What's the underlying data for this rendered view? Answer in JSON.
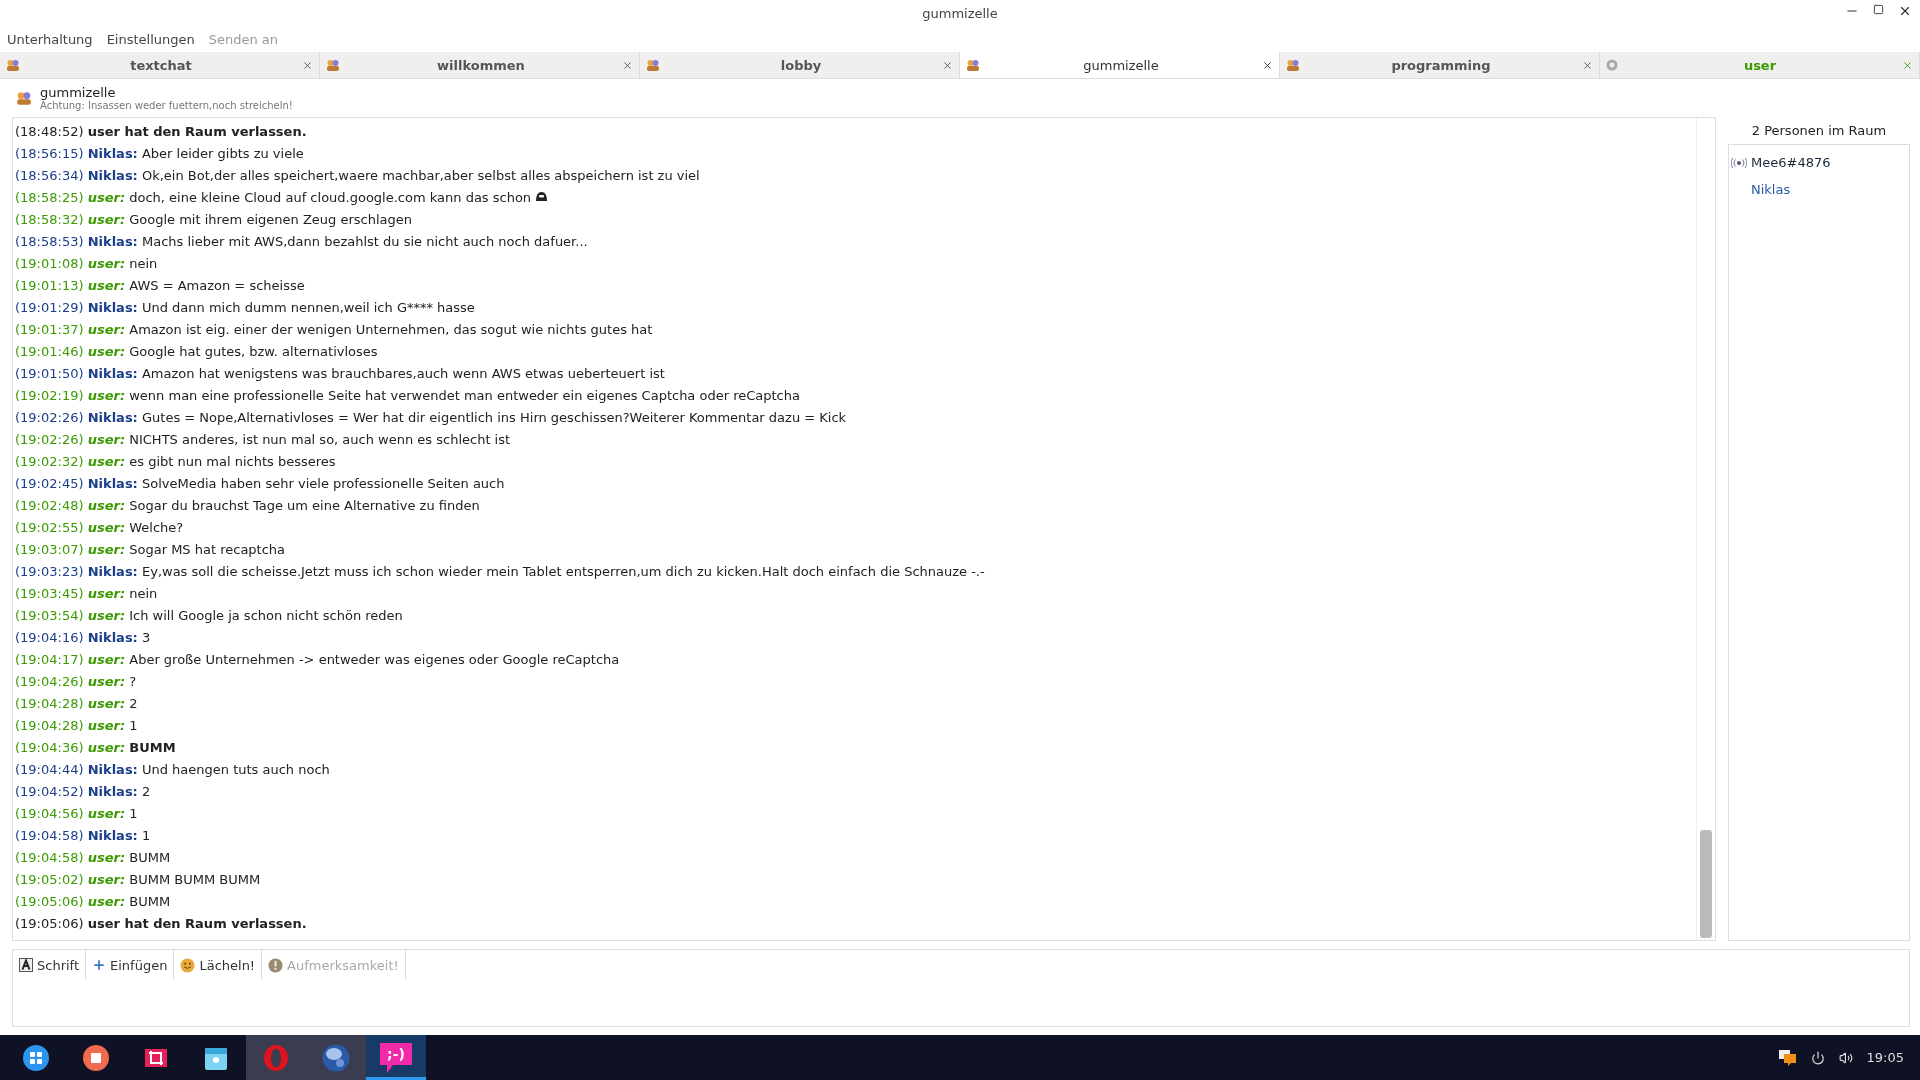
{
  "window": {
    "title": "gummizelle"
  },
  "menu": [
    "Unterhaltung",
    "Einstellungen",
    {
      "label": "Senden an",
      "disabled": true
    }
  ],
  "tabs": [
    {
      "label": "textchat",
      "selected": false,
      "highlighted": false,
      "kind": "group"
    },
    {
      "label": "willkommen",
      "selected": false,
      "highlighted": false,
      "kind": "group"
    },
    {
      "label": "lobby",
      "selected": false,
      "highlighted": false,
      "kind": "group"
    },
    {
      "label": "gummizelle",
      "selected": true,
      "highlighted": false,
      "kind": "group"
    },
    {
      "label": "programming",
      "selected": false,
      "highlighted": false,
      "kind": "group"
    },
    {
      "label": "user",
      "selected": false,
      "highlighted": true,
      "kind": "private"
    }
  ],
  "room": {
    "name": "gummizelle",
    "topic": "Achtung: Insassen weder fuettern,noch streicheln!"
  },
  "messages": [
    {
      "kind": "system",
      "time": "(18:48:52)",
      "text": "user hat den Raum verlassen."
    },
    {
      "kind": "other",
      "time": "(18:56:15)",
      "nick": "Niklas:",
      "text": "Aber leider gibts zu viele"
    },
    {
      "kind": "other",
      "time": "(18:56:34)",
      "nick": "Niklas:",
      "text": "Ok,ein Bot,der alles speichert,waere machbar,aber selbst alles abspeichern ist zu viel"
    },
    {
      "kind": "self",
      "time": "(18:58:25)",
      "nick": "user:",
      "text": "doch, eine kleine Cloud auf cloud.google.com kann das schon",
      "emoji": true
    },
    {
      "kind": "self",
      "time": "(18:58:32)",
      "nick": "user:",
      "text": "Google mit ihrem eigenen Zeug erschlagen"
    },
    {
      "kind": "other",
      "time": "(18:58:53)",
      "nick": "Niklas:",
      "text": "Machs lieber mit AWS,dann bezahlst du sie nicht auch noch dafuer..."
    },
    {
      "kind": "self",
      "time": "(19:01:08)",
      "nick": "user:",
      "text": "nein"
    },
    {
      "kind": "self",
      "time": "(19:01:13)",
      "nick": "user:",
      "text": "AWS = Amazon = scheisse"
    },
    {
      "kind": "other",
      "time": "(19:01:29)",
      "nick": "Niklas:",
      "text": "Und dann mich dumm nennen,weil ich G**** hasse"
    },
    {
      "kind": "self",
      "time": "(19:01:37)",
      "nick": "user:",
      "text": "Amazon ist eig. einer der wenigen Unternehmen, das sogut wie nichts gutes hat"
    },
    {
      "kind": "self",
      "time": "(19:01:46)",
      "nick": "user:",
      "text": "Google hat gutes, bzw. alternativloses"
    },
    {
      "kind": "other",
      "time": "(19:01:50)",
      "nick": "Niklas:",
      "text": "Amazon hat wenigstens was brauchbares,auch wenn AWS etwas ueberteuert ist"
    },
    {
      "kind": "self",
      "time": "(19:02:19)",
      "nick": "user:",
      "text": "wenn man eine professionelle Seite hat verwendet man entweder ein eigenes Captcha oder reCaptcha"
    },
    {
      "kind": "other",
      "time": "(19:02:26)",
      "nick": "Niklas:",
      "text": "Gutes = Nope,Alternativloses = Wer hat dir eigentlich ins Hirn geschissen?Weiterer Kommentar dazu = Kick"
    },
    {
      "kind": "self",
      "time": "(19:02:26)",
      "nick": "user:",
      "text": "NICHTS anderes, ist nun mal so, auch wenn es schlecht ist"
    },
    {
      "kind": "self",
      "time": "(19:02:32)",
      "nick": "user:",
      "text": "es gibt nun mal nichts besseres"
    },
    {
      "kind": "other",
      "time": "(19:02:45)",
      "nick": "Niklas:",
      "text": "SolveMedia haben sehr viele professionelle Seiten auch"
    },
    {
      "kind": "self",
      "time": "(19:02:48)",
      "nick": "user:",
      "text": "Sogar du brauchst Tage um eine Alternative zu finden"
    },
    {
      "kind": "self",
      "time": "(19:02:55)",
      "nick": "user:",
      "text": "Welche?"
    },
    {
      "kind": "self",
      "time": "(19:03:07)",
      "nick": "user:",
      "text": "Sogar MS hat recaptcha"
    },
    {
      "kind": "other",
      "time": "(19:03:23)",
      "nick": "Niklas:",
      "text": "Ey,was soll die scheisse.Jetzt muss ich schon wieder mein Tablet entsperren,um dich zu kicken.Halt doch einfach die Schnauze -.-"
    },
    {
      "kind": "self",
      "time": "(19:03:45)",
      "nick": "user:",
      "text": "nein"
    },
    {
      "kind": "self",
      "time": "(19:03:54)",
      "nick": "user:",
      "text": "Ich will Google ja schon nicht schön reden"
    },
    {
      "kind": "other",
      "time": "(19:04:16)",
      "nick": "Niklas:",
      "text": "3"
    },
    {
      "kind": "self",
      "time": "(19:04:17)",
      "nick": "user:",
      "text": "Aber große Unternehmen -> entweder was eigenes oder Google reCaptcha"
    },
    {
      "kind": "self",
      "time": "(19:04:26)",
      "nick": "user:",
      "text": "?"
    },
    {
      "kind": "self",
      "time": "(19:04:28)",
      "nick": "user:",
      "text": "2"
    },
    {
      "kind": "self",
      "time": "(19:04:28)",
      "nick": "user:",
      "text": "1"
    },
    {
      "kind": "self",
      "time": "(19:04:36)",
      "nick": "user:",
      "text": "BUMM",
      "bold": true
    },
    {
      "kind": "other",
      "time": "(19:04:44)",
      "nick": "Niklas:",
      "text": "Und haengen tuts auch noch"
    },
    {
      "kind": "other",
      "time": "(19:04:52)",
      "nick": "Niklas:",
      "text": "2"
    },
    {
      "kind": "self",
      "time": "(19:04:56)",
      "nick": "user:",
      "text": "1"
    },
    {
      "kind": "other",
      "time": "(19:04:58)",
      "nick": "Niklas:",
      "text": "1"
    },
    {
      "kind": "self",
      "time": "(19:04:58)",
      "nick": "user:",
      "text": "BUMM"
    },
    {
      "kind": "self",
      "time": "(19:05:02)",
      "nick": "user:",
      "text": "BUMM BUMM BUMM"
    },
    {
      "kind": "self",
      "time": "(19:05:06)",
      "nick": "user:",
      "text": "BUMM"
    },
    {
      "kind": "system",
      "time": "(19:05:06)",
      "text": "user hat den Raum verlassen."
    }
  ],
  "members": {
    "title": "2 Personen im Raum",
    "items": [
      {
        "name": "Mee6#4876",
        "kind": "bot"
      },
      {
        "name": "Niklas",
        "kind": "person"
      }
    ]
  },
  "toolbar": [
    {
      "label": "Schrift",
      "kind": "font",
      "disabled": false
    },
    {
      "label": "Einfügen",
      "kind": "insert",
      "disabled": false
    },
    {
      "label": "Lächeln!",
      "kind": "smile",
      "disabled": false
    },
    {
      "label": "Aufmerksamkeit!",
      "kind": "attention",
      "disabled": true
    }
  ],
  "taskbar": {
    "apps": [
      {
        "kind": "launcher",
        "active": false,
        "open": false
      },
      {
        "kind": "record",
        "active": false,
        "open": false
      },
      {
        "kind": "crop",
        "active": false,
        "open": false
      },
      {
        "kind": "files",
        "active": false,
        "open": false
      },
      {
        "kind": "opera",
        "active": false,
        "open": true
      },
      {
        "kind": "globe",
        "active": false,
        "open": true
      },
      {
        "kind": "chat",
        "active": true,
        "open": true,
        "label": ";-)"
      }
    ],
    "clock": "19:05"
  }
}
